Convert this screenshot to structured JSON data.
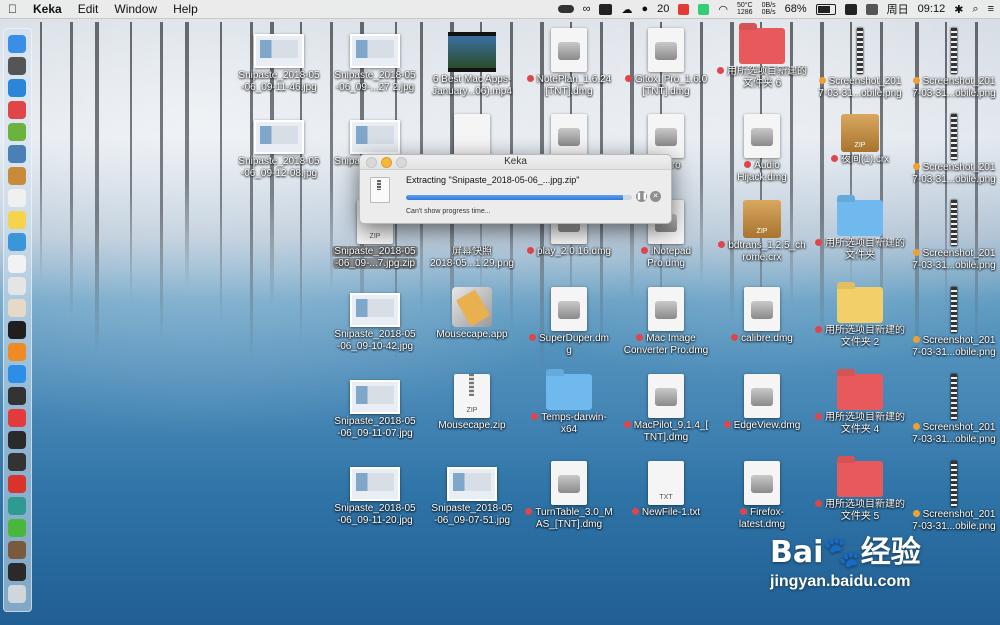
{
  "menubar": {
    "app_name": "Keka",
    "menus": [
      "Edit",
      "Window",
      "Help"
    ],
    "status": {
      "number": "20",
      "temp": "50°C",
      "rpm": "1286",
      "net_up": "0B/s",
      "net_down": "0B/s",
      "battery": "68%",
      "day": "周日",
      "time": "09:12"
    }
  },
  "dialog": {
    "title": "Keka",
    "message": "Extracting \"Snipaste_2018-05-06_...jpg.zip\"",
    "status": "Can't show progress time...",
    "progress": 0.96
  },
  "desktop": {
    "items": [
      {
        "label": "Snipaste_2018-05\n-06_09-11-46.jpg",
        "kind": "thumb"
      },
      {
        "label": "Snipaste_2018-05\n-06_09-...27 2.jpg",
        "kind": "thumb"
      },
      {
        "label": "6 Best Mac Apps-\nJanuary...06).mp4",
        "kind": "video"
      },
      {
        "label": "NotePlan_1.6.24\n[TNT].dmg",
        "kind": "disk",
        "dot": "#e0454a"
      },
      {
        "label": "Gitox_Pro_1.6.0\n[TNT].dmg",
        "kind": "disk",
        "dot": "#e0454a"
      },
      {
        "label": "用所选项目新建的\n文件夹 6",
        "kind": "folder-red",
        "dot": "#e0454a"
      },
      {
        "label": "Screenshot_201\n7-03-31...obile.png",
        "kind": "strip",
        "dot": "#f0a030"
      },
      {
        "label": "Screenshot_201\n7-03-31...obile.png",
        "kind": "strip",
        "dot": "#f0a030"
      },
      {
        "label": "Snipaste_2018-05\n-06_09-12-08.jpg",
        "kind": "thumb"
      },
      {
        "label": "Snipaste_2018-05\n-06_0",
        "kind": "thumb"
      },
      {
        "label": "",
        "kind": "doc-v"
      },
      {
        "label": "",
        "kind": "disk"
      },
      {
        "label": "ad Pro",
        "kind": "disk"
      },
      {
        "label": "Audio\nHijack.dmg",
        "kind": "disk",
        "dot": "#e0454a"
      },
      {
        "label": "夜间(1).crx",
        "kind": "zip",
        "dot": "#e0454a"
      },
      {
        "label": "Screenshot_201\n7-03-31...obile.png",
        "kind": "strip",
        "dot": "#f0a030"
      },
      {
        "label": "Snipaste_2018-05\n-06_09-...7.jpg.zip",
        "kind": "zip-doc",
        "selected": true
      },
      {
        "label": "屏幕快照\n2018-05...1.29.png",
        "kind": "none"
      },
      {
        "label": "play_2.0.16.dmg",
        "kind": "disk",
        "dot": "#e0454a"
      },
      {
        "label": "iNotepad\nPro.dmg",
        "kind": "disk",
        "dot": "#e0454a"
      },
      {
        "label": "bdtrans_1.2.5_ch\nrome.crx",
        "kind": "box",
        "dot": "#e0454a"
      },
      {
        "label": "用所选项目新建的\n文件夹",
        "kind": "folder-blue",
        "dot": "#e0454a"
      },
      {
        "label": "Screenshot_201\n7-03-31...obile.png",
        "kind": "strip",
        "dot": "#f0a030"
      },
      {
        "label": "Snipaste_2018-05\n-06_09-10-42.jpg",
        "kind": "thumb"
      },
      {
        "label": "Mousecape.app",
        "kind": "app"
      },
      {
        "label": "SuperDuper.dm\ng",
        "kind": "disk",
        "dot": "#e0454a"
      },
      {
        "label": "Mac Image\nConverter Pro.dmg",
        "kind": "disk",
        "dot": "#e0454a"
      },
      {
        "label": "calibre.dmg",
        "kind": "disk",
        "dot": "#e0454a"
      },
      {
        "label": "用所选项目新建的\n文件夹 2",
        "kind": "folder-yellow",
        "dot": "#e0454a"
      },
      {
        "label": "Screenshot_201\n7-03-31...obile.png",
        "kind": "strip",
        "dot": "#f0a030"
      },
      {
        "label": "Snipaste_2018-05\n-06_09-11-07.jpg",
        "kind": "thumb"
      },
      {
        "label": "Mousecape.zip",
        "kind": "zip-doc"
      },
      {
        "label": "Temps-darwin-\nx64",
        "kind": "folder-blue",
        "dot": "#e0454a"
      },
      {
        "label": "MacPilot_9.1.4_[\nTNT].dmg",
        "kind": "disk",
        "dot": "#e0454a"
      },
      {
        "label": "EdgeView.dmg",
        "kind": "disk",
        "dot": "#e0454a"
      },
      {
        "label": "用所选项目新建的\n文件夹 4",
        "kind": "folder-red",
        "dot": "#e0454a"
      },
      {
        "label": "Screenshot_201\n7-03-31...obile.png",
        "kind": "strip",
        "dot": "#f0a030"
      },
      {
        "label": "Snipaste_2018-05\n-06_09-11-20.jpg",
        "kind": "thumb"
      },
      {
        "label": "Snipaste_2018-05\n-06_09-07-51.jpg",
        "kind": "thumb"
      },
      {
        "label": "TurnTable_3.0_M\nAS_[TNT].dmg",
        "kind": "disk",
        "dot": "#e0454a"
      },
      {
        "label": "NewFile-1.txt",
        "kind": "txt",
        "dot": "#e0454a"
      },
      {
        "label": "Firefox-\nlatest.dmg",
        "kind": "disk",
        "dot": "#e0454a"
      },
      {
        "label": "用所选项目新建的\n文件夹 5",
        "kind": "folder-red",
        "dot": "#e0454a"
      },
      {
        "label": "Screenshot_201\n7-03-31...obile.png",
        "kind": "strip",
        "dot": "#f0a030"
      }
    ],
    "zip_text": "ZIP",
    "txt_text": "TXT"
  },
  "watermark": {
    "brand": "Bai",
    "brand2": "经验",
    "url": "jingyan.baidu.com"
  },
  "dock": {
    "items": [
      "finder-icon",
      "launchpad-icon",
      "safari-icon",
      "download-icon",
      "android-icon",
      "preview-icon",
      "photos-icon",
      "calendar-icon",
      "notes-icon",
      "contacts-icon",
      "reminders-icon",
      "chrome-icon",
      "photos2-icon",
      "terminal-icon",
      "books-icon",
      "appstore-icon",
      "vpn-icon",
      "vivaldi-icon",
      "activity-icon",
      "console-icon",
      "netease-icon",
      "edge-icon",
      "wechat-icon",
      "avatar-icon",
      "keka-icon",
      "trash-icon"
    ],
    "colors": [
      "#3a8ee6",
      "#555",
      "#2c86d8",
      "#e0454a",
      "#6bb33c",
      "#4b7fb5",
      "#c98a3a",
      "#f0f0f0",
      "#f5d34a",
      "#3b95d9",
      "#f2f2f2",
      "#e5e5e5",
      "#e6d9c8",
      "#1f1f1f",
      "#f08a24",
      "#2c8ee6",
      "#333",
      "#e33b3b",
      "#2a2a2a",
      "#333",
      "#d9332b",
      "#2f9a92",
      "#49b83a",
      "#7a5a3d",
      "#2a2a2a",
      "#cfd6dc"
    ]
  }
}
